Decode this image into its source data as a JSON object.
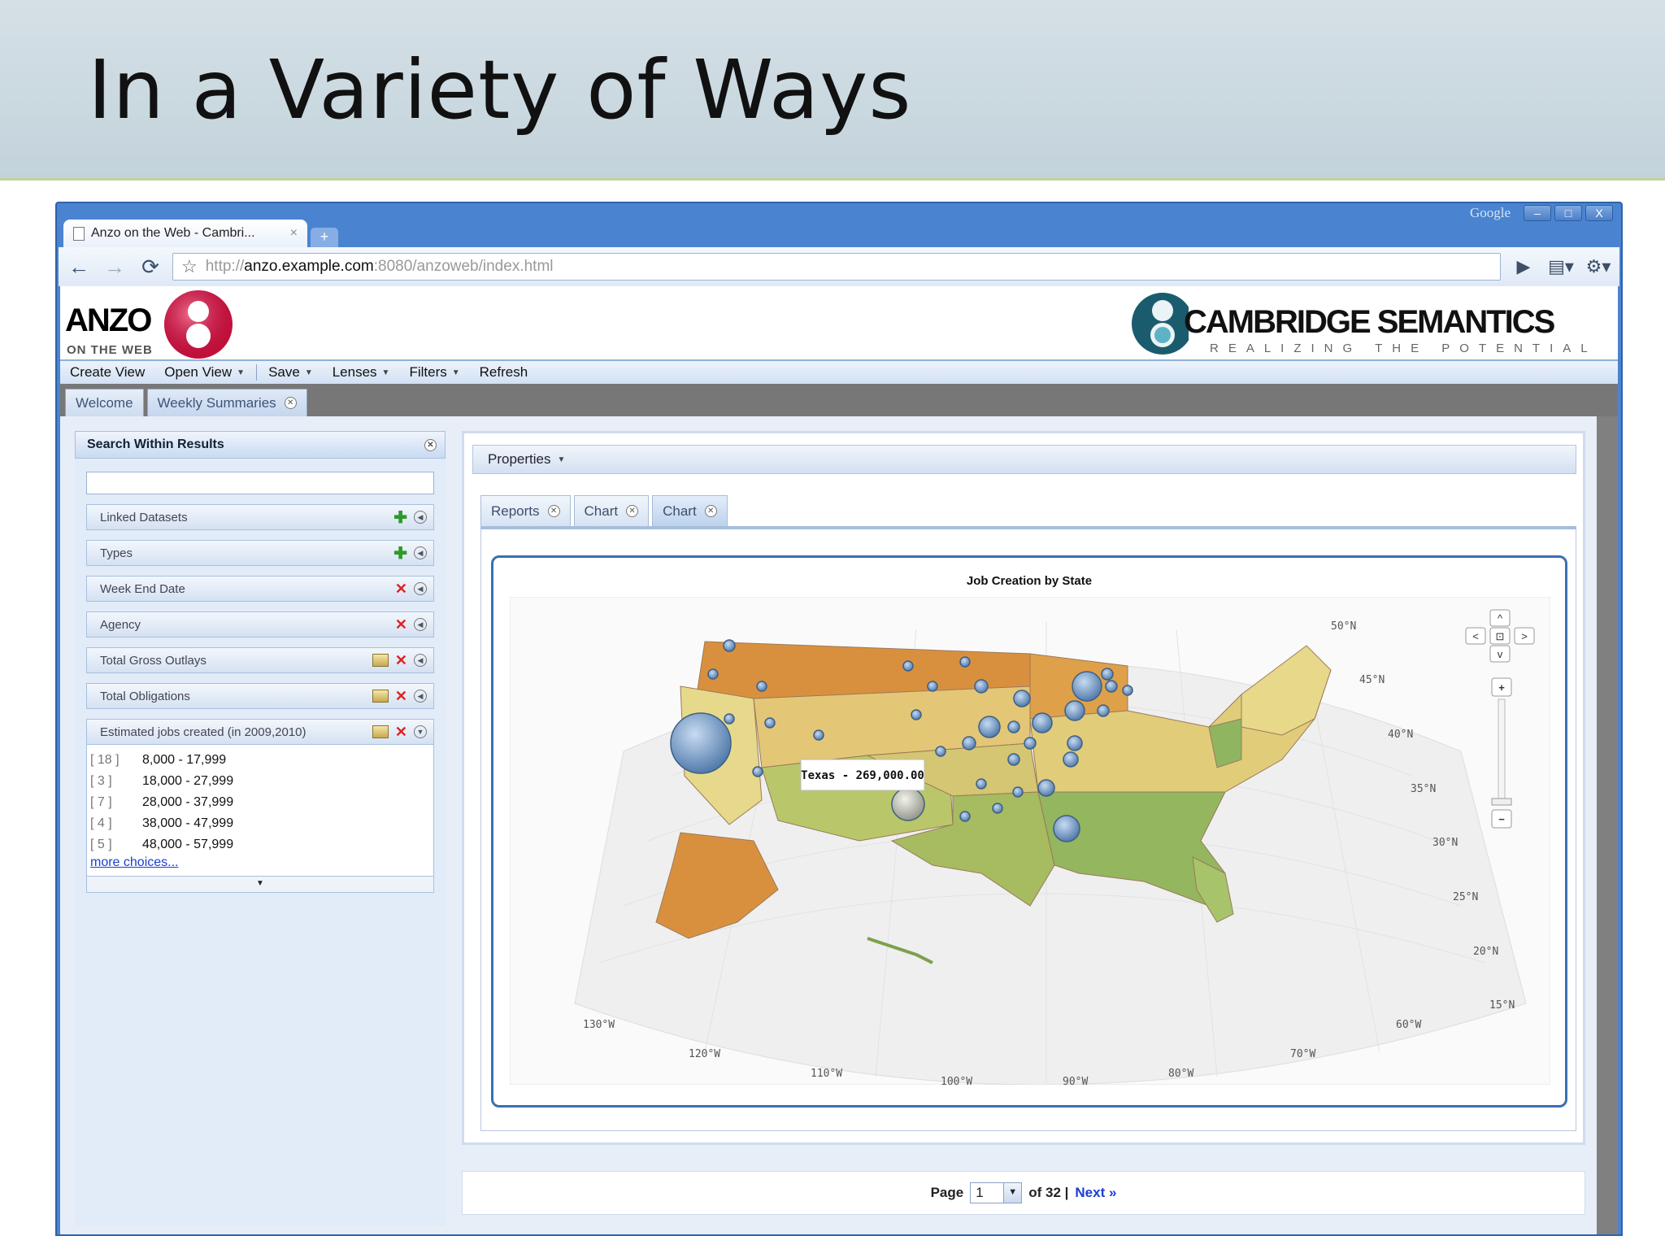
{
  "slide": {
    "title": "In a Variety of Ways"
  },
  "browser": {
    "tab_title": "Anzo on the Web - Cambri...",
    "tab_close": "×",
    "new_tab": "+",
    "google_label": "Google",
    "url_scheme": "http://",
    "url_host": "anzo.example.com",
    "url_rest": ":8080/anzoweb/index.html",
    "win_min": "–",
    "win_max": "□",
    "win_close": "X"
  },
  "app": {
    "anzo_logo_text": "ANZO",
    "anzo_logo_sub": "ON THE WEB",
    "cs_logo_text": "CAMBRIDGE SEMANTICS",
    "cs_logo_sub": "REALIZING THE POTENTIAL",
    "menu": [
      "Create View",
      "Open View",
      "Save",
      "Lenses",
      "Filters",
      "Refresh"
    ],
    "view_tabs": [
      "Welcome",
      "Weekly Summaries"
    ]
  },
  "search_panel": {
    "title": "Search Within Results",
    "search_value": "",
    "facets": [
      "Linked Datasets",
      "Types",
      "Week End Date",
      "Agency",
      "Total Gross Outlays",
      "Total Obligations",
      "Estimated jobs created (in 2009,2010)"
    ],
    "ranges": [
      {
        "count": "[ 18 ]",
        "label": "8,000 - 17,999"
      },
      {
        "count": "[ 3 ]",
        "label": "18,000 - 27,999"
      },
      {
        "count": "[ 7 ]",
        "label": "28,000 - 37,999"
      },
      {
        "count": "[ 4 ]",
        "label": "38,000 - 47,999"
      },
      {
        "count": "[ 5 ]",
        "label": "48,000 - 57,999"
      }
    ],
    "more_choices": "more choices..."
  },
  "main_panel": {
    "properties_label": "Properties",
    "tabs": [
      "Reports",
      "Chart",
      "Chart"
    ],
    "chart_title": "Job Creation by State",
    "tooltip": "Texas - 269,000.00"
  },
  "chart_data": {
    "type": "map",
    "title": "Job Creation by State",
    "tooltip": {
      "state": "Texas",
      "value": 269000
    },
    "lat_labels": [
      "50°N",
      "45°N",
      "40°N",
      "35°N",
      "30°N",
      "25°N",
      "20°N",
      "15°N"
    ],
    "lon_labels": [
      "130°W",
      "120°W",
      "110°W",
      "100°W",
      "90°W",
      "80°W",
      "70°W",
      "60°W"
    ],
    "colors": {
      "high": "#d9903e",
      "mid": "#e8d88a",
      "low": "#8fb561"
    }
  },
  "pager": {
    "page_label": "Page",
    "current": "1",
    "of_label": "of 32 |",
    "next": "Next »"
  }
}
